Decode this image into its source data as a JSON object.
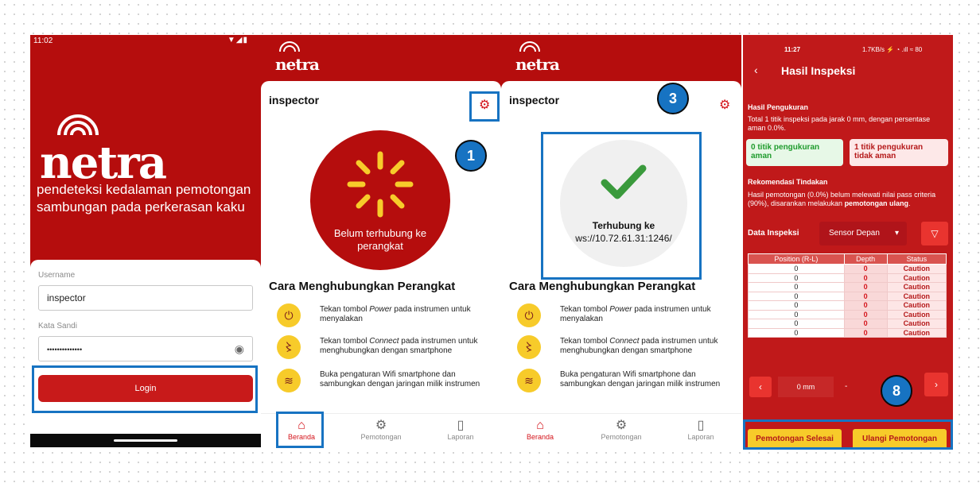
{
  "login": {
    "status_time": "11:02",
    "status_icons": "▼◢▮",
    "logo": "netra",
    "tagline": "pendeteksi kedalaman pemotongan sambungan pada perkerasan kaku",
    "username_label": "Username",
    "username_value": "inspector",
    "password_label": "Kata Sandi",
    "password_value": "••••••••••••••",
    "login_button": "Login"
  },
  "home1": {
    "logo": "netra",
    "user": "inspector",
    "status_text": "Belum terhubung ke perangkat",
    "badge": "1"
  },
  "home2": {
    "logo": "netra",
    "user": "inspector",
    "connected_prefix": "Terhubung ke",
    "connected_url": " ws://10.72.61.31:1246/",
    "badge": "3"
  },
  "steps": {
    "heading": "Cara Menghubungkan Perangkat",
    "items": [
      {
        "pre": "Tekan tombol ",
        "em": "Power",
        "post": " pada instrumen untuk menyalakan"
      },
      {
        "pre": "Tekan tombol ",
        "em": "Connect",
        "post": " pada instrumen untuk menghubungkan dengan smartphone"
      },
      {
        "pre": "Buka pengaturan Wifi smartphone dan sambungkan dengan jaringan milik instrumen",
        "em": "",
        "post": ""
      }
    ]
  },
  "nav": {
    "home": "Beranda",
    "cut": "Pemotongan",
    "report": "Laporan"
  },
  "result": {
    "status_time": "11:27",
    "status_right": "1.7KB/s ⚡ ◔ .ıll ≈ 80",
    "title": "Hasil Inspeksi",
    "h_measure": "Hasil Pengukuran",
    "measure_text": "Total 1 titik inspeksi pada jarak 0 mm, dengan persentase aman 0.0%.",
    "safe_box": "0 titik pengukuran aman",
    "unsafe_box": "1 titik pengukuran tidak aman",
    "h_rec": "Rekomendasi Tindakan",
    "rec_pre": "Hasil pemotongan (0.0%) belum melewati nilai pass criteria (90%), disarankan melakukan ",
    "rec_bold": "pemotongan ulang",
    "rec_post": ".",
    "h_data": "Data Inspeksi",
    "sensor": "Sensor Depan",
    "columns": [
      "Position (R-L)",
      "Depth",
      "Status"
    ],
    "rows": [
      [
        "0",
        "0",
        "Caution"
      ],
      [
        "0",
        "0",
        "Caution"
      ],
      [
        "0",
        "0",
        "Caution"
      ],
      [
        "0",
        "0",
        "Caution"
      ],
      [
        "0",
        "0",
        "Caution"
      ],
      [
        "0",
        "0",
        "Caution"
      ],
      [
        "0",
        "0",
        "Caution"
      ],
      [
        "0",
        "0",
        "Caution"
      ]
    ],
    "pager_value": "0 mm",
    "pager_dash": "-",
    "btn_done": "Pemotongan Selesai",
    "btn_redo": "Ulangi Pemotongan",
    "badge": "8"
  },
  "colors": {
    "brand_red": "#b50d0d",
    "annotation_blue": "#1773c2",
    "yellow": "#f7cb2a",
    "green": "#1f9b2d"
  }
}
